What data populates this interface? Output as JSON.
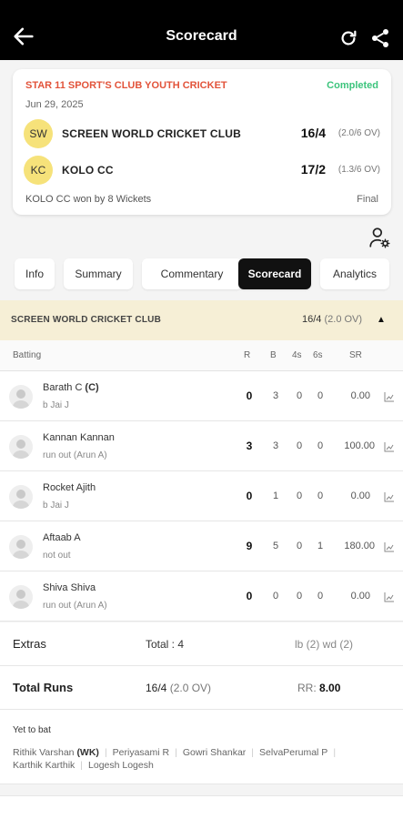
{
  "appbar": {
    "title": "Scorecard"
  },
  "match": {
    "tournament": "STAR 11 SPORT'S CLUB YOUTH CRICKET",
    "status": "Completed",
    "date": "Jun 29, 2025",
    "status_color": "#3cc47c",
    "tournament_color": "#e2533a",
    "teams": [
      {
        "badge": "SW",
        "name": "SCREEN WORLD CRICKET CLUB",
        "score": "16/4",
        "overs": "(2.0/6 OV)"
      },
      {
        "badge": "KC",
        "name": "KOLO CC",
        "score": "17/2",
        "overs": "(1.3/6 OV)"
      }
    ],
    "result": "KOLO CC won by 8 Wickets",
    "final_label": "Final"
  },
  "tabs": [
    "Info",
    "Summary",
    "Commentary",
    "Scorecard",
    "Analytics"
  ],
  "active_tab": "Scorecard",
  "innings": {
    "team": "SCREEN WORLD CRICKET CLUB",
    "score": "16/4",
    "overs": "(2.0 OV)"
  },
  "batting_header": {
    "label": "Batting",
    "r": "R",
    "b": "B",
    "fours": "4s",
    "sixes": "6s",
    "sr": "SR"
  },
  "batters": [
    {
      "name": "Barath C",
      "tag": "(C)",
      "dismissal": "b Jai J",
      "r": "0",
      "b": "3",
      "fours": "0",
      "sixes": "0",
      "sr": "0.00"
    },
    {
      "name": "Kannan Kannan",
      "tag": "",
      "dismissal": "run out (Arun A)",
      "r": "3",
      "b": "3",
      "fours": "0",
      "sixes": "0",
      "sr": "100.00"
    },
    {
      "name": "Rocket Ajith",
      "tag": "",
      "dismissal": "b Jai J",
      "r": "0",
      "b": "1",
      "fours": "0",
      "sixes": "0",
      "sr": "0.00"
    },
    {
      "name": "Aftaab A",
      "tag": "",
      "dismissal": "not out",
      "r": "9",
      "b": "5",
      "fours": "0",
      "sixes": "1",
      "sr": "180.00"
    },
    {
      "name": "Shiva Shiva",
      "tag": "",
      "dismissal": "run out (Arun A)",
      "r": "0",
      "b": "0",
      "fours": "0",
      "sixes": "0",
      "sr": "0.00"
    }
  ],
  "extras": {
    "label": "Extras",
    "total": "Total : 4",
    "detail": "lb (2) wd (2)"
  },
  "total_runs": {
    "label": "Total Runs",
    "score": "16/4",
    "overs": "(2.0 OV)",
    "rr_label": "RR:",
    "rr_value": "8.00"
  },
  "yet_to_bat": {
    "label": "Yet to bat",
    "players": [
      {
        "name": "Rithik Varshan",
        "tag": "(WK)"
      },
      {
        "name": "Periyasami R",
        "tag": ""
      },
      {
        "name": "Gowri Shankar",
        "tag": ""
      },
      {
        "name": "SelvaPerumal P",
        "tag": ""
      },
      {
        "name": "Karthik Karthik",
        "tag": ""
      },
      {
        "name": "Logesh Logesh",
        "tag": ""
      }
    ]
  }
}
